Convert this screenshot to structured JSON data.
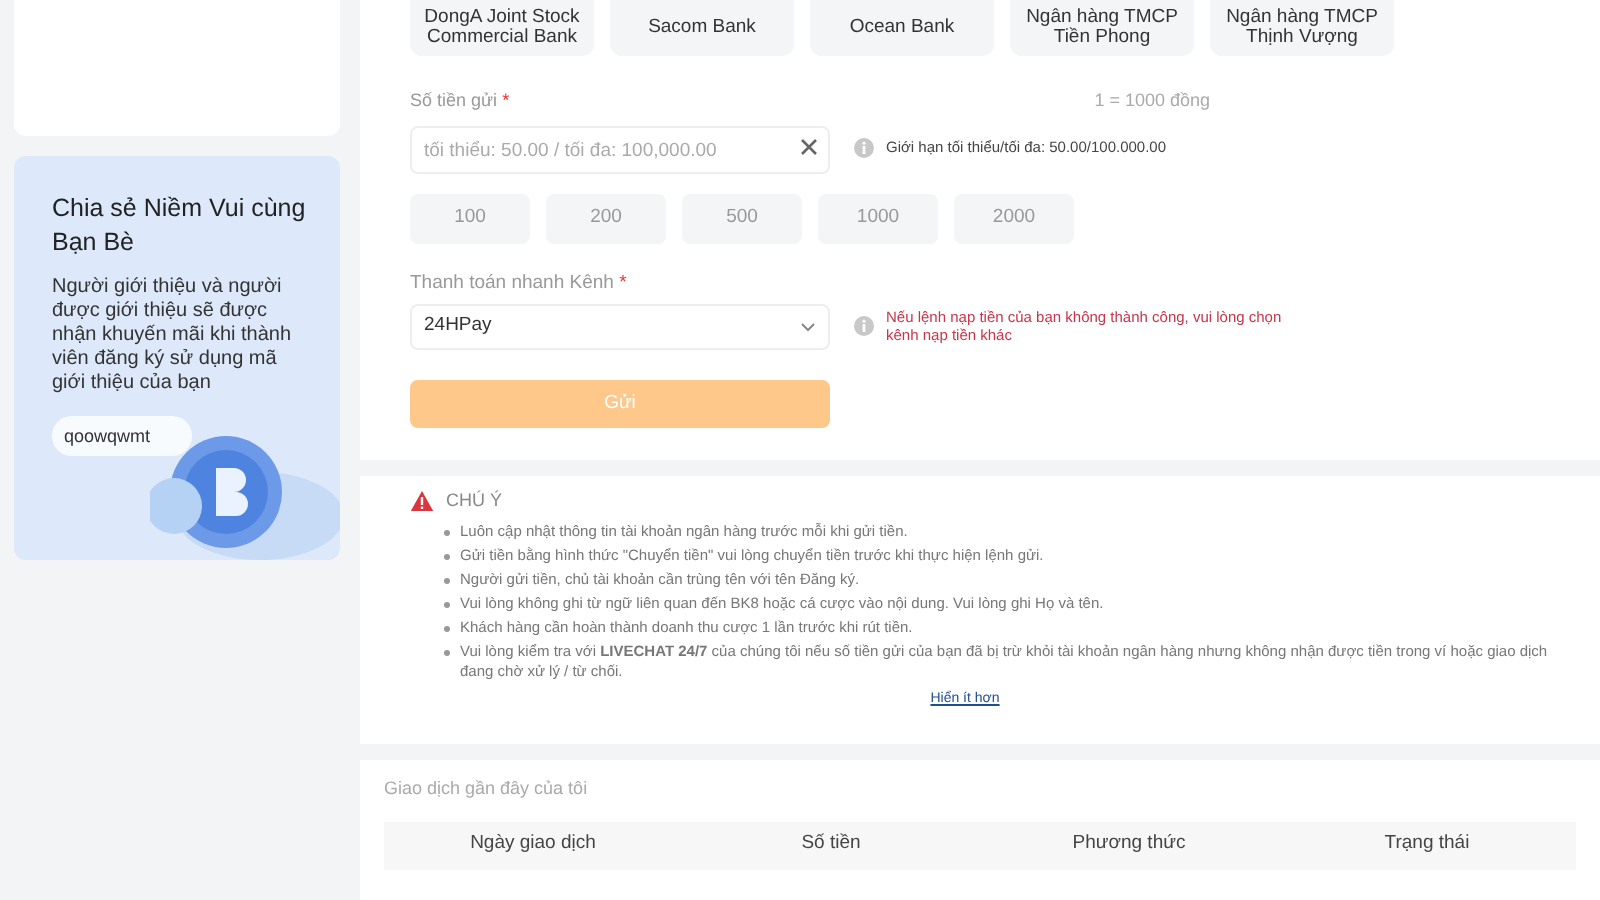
{
  "banks": [
    {
      "name": "DongA Joint Stock Commercial Bank"
    },
    {
      "name": "Sacom Bank"
    },
    {
      "name": "Ocean Bank"
    },
    {
      "name": "Ngân hàng TMCP Tiền Phong"
    },
    {
      "name": "Ngân hàng TMCP Thịnh Vượng"
    }
  ],
  "amount": {
    "label": "Số tiền gửi",
    "required": "*",
    "rate": "1 = 1000 đồng",
    "placeholder": "tối thiểu: 50.00 / tối đa: 100,000.00",
    "hint": "Giới hạn tối thiểu/tối đa: 50.00/100.000.00"
  },
  "quick_amounts": [
    "100",
    "200",
    "500",
    "1000",
    "2000"
  ],
  "channel": {
    "label": "Thanh toán nhanh Kênh",
    "required": "*",
    "value": "24HPay",
    "warning": "Nếu lệnh nạp tiền của bạn không thành công, vui lòng chọn kênh nạp tiền khác"
  },
  "submit": {
    "label": "Gửi",
    "disabled": true
  },
  "referral": {
    "title": "Chia sẻ Niềm Vui cùng Bạn Bè",
    "text": "Người giới thiệu và người được giới thiệu sẽ được nhận khuyến mãi khi thành viên đăng ký sử dụng mã giới thiệu của bạn",
    "code": "qoowqwmt"
  },
  "notice": {
    "title": "CHÚ Ý",
    "items": [
      "Luôn cập nhật thông tin tài khoản ngân hàng trước mỗi khi gửi tiền.",
      "Gửi tiền bằng hình thức \"Chuyển tiền\" vui lòng chuyển tiền trước khi thực hiện lệnh gửi.",
      "Người gửi tiền, chủ tài khoản cần trùng tên với tên Đăng ký.",
      "Vui lòng không ghi từ ngữ liên quan đến BK8 hoặc cá cược vào nội dung. Vui lòng ghi Họ và tên.",
      "Khách hàng cần hoàn thành doanh thu cược 1 lần trước khi rút tiền.",
      "Vui lòng kiểm tra với **LIVECHAT 24/7** của chúng tôi nếu số tiền gửi của bạn đã bị trừ khỏi tài khoản ngân hàng nhưng không nhận được tiền trong ví hoặc giao dịch đang chờ xử lý / từ chối."
    ],
    "toggle": "Hiển ít hơn"
  },
  "history": {
    "title": "Giao dịch gần đây của tôi",
    "columns": [
      "Ngày giao dịch",
      "Số tiền",
      "Phương thức",
      "Trạng thái"
    ]
  }
}
